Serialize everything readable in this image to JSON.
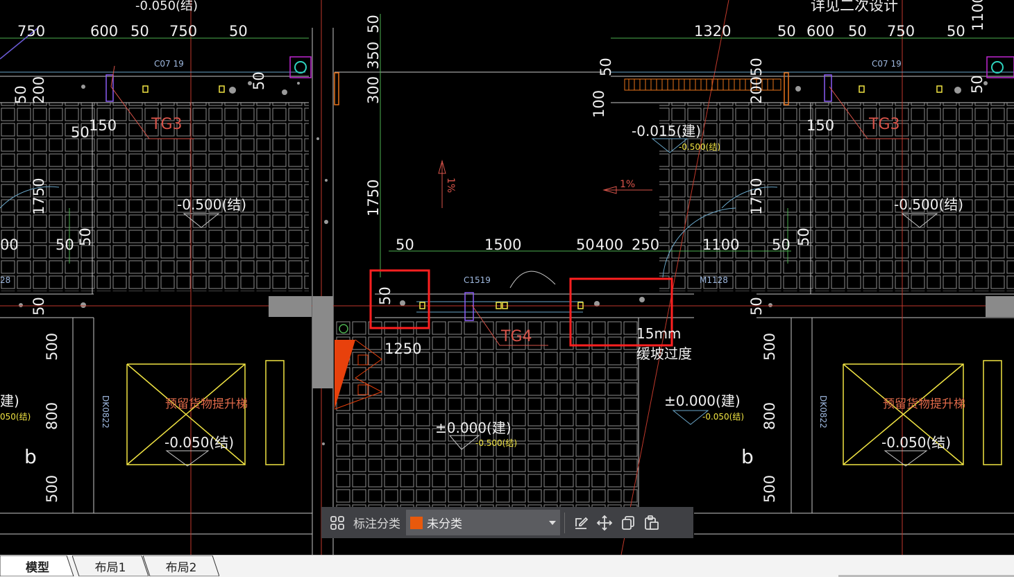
{
  "drawing": {
    "top_note": "详见二次设计",
    "dims_top_left": [
      "750",
      "600",
      "50",
      "750",
      "50"
    ],
    "dims_top_right": [
      "1320",
      "50",
      "600",
      "50",
      "750",
      "50"
    ],
    "dims_mid": [
      "50",
      "1500",
      "50",
      "400",
      "250",
      "1100",
      "50"
    ],
    "dims_vertical_center": [
      "50",
      "350",
      "300",
      "1750"
    ],
    "dim_50": "50",
    "dim_150": "150",
    "dim_200": "200",
    "dim_1750": "1750",
    "dim_100": "100",
    "dim_500": "500",
    "dim_800": "800",
    "dim_1100": "1100",
    "dim_1250": "1250",
    "dim_00": "00",
    "window_tag_left": "C07 19",
    "window_tag_right": "C07 19",
    "window_tag_center": "C1519",
    "door_tag": "M1128",
    "beam_tg3": "TG3",
    "beam_tg4": "TG4",
    "elev_jian_015": "-0.015(建)",
    "elev_jie_500": "-0.500(结)",
    "elev_jie_050": "-0.050(结)",
    "elev_jian_000": "±0.000(建)",
    "elev_small_050": "-0.050(结)",
    "elev_small_500": "-0.500(结)",
    "slope": "1%",
    "slope_vertical": "1%",
    "fifteen_mm": "15mm",
    "slope_transition": "缓坡过度",
    "lift_label": "预留货物提升梯",
    "dk_tag": "DK0822",
    "b_mark": "b",
    "partial_jian": "建)",
    "partial_jie": "050(结)",
    "partial_28": "28"
  },
  "toolbar": {
    "label": "标注分类",
    "selected_category": "未分类",
    "category_color": "#e8590c"
  },
  "tabs": [
    {
      "label": "模型",
      "active": true
    },
    {
      "label": "布局1",
      "active": false
    },
    {
      "label": "布局2",
      "active": false
    }
  ],
  "colors": {
    "background": "#000000",
    "highlight": "#ff2020",
    "toolbar_bg": "#3f4044"
  }
}
